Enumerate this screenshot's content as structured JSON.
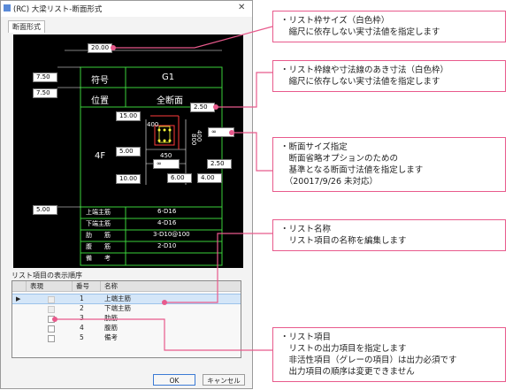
{
  "dialog": {
    "title": "(RC) 大梁リスト-断面形式",
    "close_icon": "close-icon",
    "tab": "断面形式",
    "preview": {
      "dim_total": "20.00",
      "dim_row1": "7.50",
      "dim_row2": "7.50",
      "dim_gap": "2.50",
      "dim_sec_w": "15.00",
      "dim_left_a": "5.00",
      "dim_left_b": "10.00",
      "dim_infinite": "∞",
      "dim_right": "2.50",
      "dim_bottom_a": "6.00",
      "dim_bottom_b": "4.00",
      "dim_base": "5.00",
      "header_label": "符号",
      "header_value": "G1",
      "pos_label": "位置",
      "pos_value": "全断面",
      "floor": "4F",
      "sec_450": "450",
      "sec_400": "400",
      "sec_height": "800",
      "sec_span": "400",
      "sec_inf": "∞",
      "rows": [
        {
          "label": "上端主筋",
          "value": "6-D16"
        },
        {
          "label": "下端主筋",
          "value": "4-D16"
        },
        {
          "label": "肋　　筋",
          "value": "3-D10@100"
        },
        {
          "label": "腹　　筋",
          "value": "2-D10"
        },
        {
          "label": "備　　考",
          "value": ""
        }
      ]
    },
    "list_label": "リスト項目の表示順序",
    "list_headers": [
      "表現",
      "番号",
      "名称"
    ],
    "list_items": [
      {
        "num": "1",
        "name": "上端主筋"
      },
      {
        "num": "2",
        "name": "下端主筋"
      },
      {
        "num": "3",
        "name": "肋筋"
      },
      {
        "num": "4",
        "name": "腹筋"
      },
      {
        "num": "5",
        "name": "備考"
      }
    ],
    "ok_label": "OK",
    "cancel_label": "キャンセル"
  },
  "callouts": [
    {
      "lines": [
        "・リスト枠サイズ（白色枠）",
        "　縮尺に依存しない実寸法値を指定します"
      ]
    },
    {
      "lines": [
        "・リスト枠線や寸法線のあき寸法（白色枠）",
        "　縮尺に依存しない実寸法値を指定します"
      ]
    },
    {
      "lines": [
        "・断面サイズ指定",
        "　断面省略オプションのための",
        "　基準となる断面寸法値を指定します",
        "　（20017/9/26 未対応）"
      ]
    },
    {
      "lines": [
        "・リスト名称",
        "　リスト項目の名称を編集します"
      ]
    },
    {
      "lines": [
        "・リスト項目",
        "　リストの出力項目を指定します",
        "　非活性項目（グレーの項目）は出力必須です",
        "　出力項目の順序は変更できません"
      ]
    }
  ],
  "colors": {
    "accent": "#e85a8c",
    "grid": "#3ad13a",
    "section": "#ff3b3b",
    "rebar": "#ffff3b",
    "ok_border": "#3b7ad4"
  }
}
